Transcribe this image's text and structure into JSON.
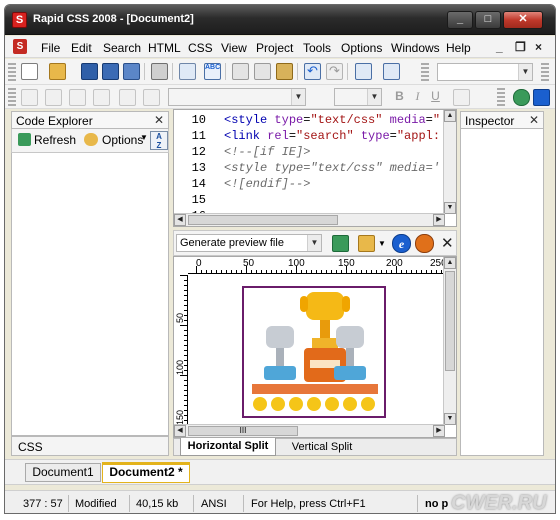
{
  "window": {
    "title": "Rapid CSS 2008 - [Document2]",
    "app_icon_letter": "S"
  },
  "menu": {
    "items": [
      "File",
      "Edit",
      "Search",
      "HTML",
      "CSS",
      "View",
      "Project",
      "Tools",
      "Options",
      "Windows",
      "Help"
    ],
    "controls": [
      "_",
      "❐",
      "×"
    ]
  },
  "explorer": {
    "title": "Code Explorer",
    "refresh_label": "Refresh",
    "options_label": "Options",
    "footer_label": "CSS"
  },
  "inspector": {
    "title": "Inspector"
  },
  "editor": {
    "lines": [
      {
        "num": "10",
        "text": "<style type=\"text/css\" media=\""
      },
      {
        "num": "11",
        "text": "<link rel=\"search\" type=\"appl:"
      },
      {
        "num": "12",
        "text": "<!--[if IE]>"
      },
      {
        "num": "13",
        "text": "<style type=\"text/css\" media='"
      },
      {
        "num": "14",
        "text": "<![endif]-->"
      },
      {
        "num": "15",
        "text": ""
      },
      {
        "num": "16",
        "text": ""
      }
    ]
  },
  "preview": {
    "combo_value": "Generate preview file",
    "ruler_h_labels": [
      "0",
      "50",
      "100",
      "150",
      "200",
      "250"
    ],
    "ruler_v_labels": [
      "50",
      "100",
      "150"
    ],
    "tabs": [
      "Horizontal Split",
      "Vertical Split"
    ],
    "hscroll_marker": "III"
  },
  "documents": {
    "tabs": [
      "Document1",
      "Document2 *"
    ]
  },
  "status": {
    "position": "377 : 57",
    "state": "Modified",
    "size": "40,15 kb",
    "encoding": "ANSI",
    "help": "For Help, press Ctrl+F1",
    "extra": "no p",
    "watermark": "CWER.RU"
  },
  "colors": {
    "accent": "#1a5fcf",
    "code_tag": "#0000b0",
    "code_attr": "#7a1aa8",
    "code_string": "#a31515",
    "code_comment": "#6a6a6a"
  }
}
